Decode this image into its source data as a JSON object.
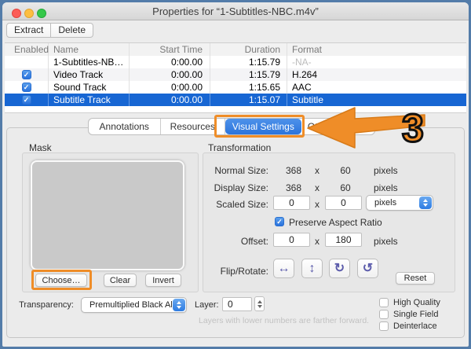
{
  "colors": {
    "accent_orange": "#ef8d28",
    "selection_blue": "#1766d3",
    "tab_blue": "#2f7de2"
  },
  "window": {
    "title": "Properties for “1-Subtitles-NBC.m4v”"
  },
  "toolbar": {
    "extract_label": "Extract",
    "delete_label": "Delete"
  },
  "track_table": {
    "columns": [
      "Enabled",
      "Name",
      "Start Time",
      "Duration",
      "Format"
    ],
    "rows": [
      {
        "enabled": false,
        "selected": false,
        "name": "1-Subtitles-NB…",
        "start_time": "0:00.00",
        "duration": "1:15.79",
        "format": "-NA-"
      },
      {
        "enabled": true,
        "selected": false,
        "name": "Video Track",
        "start_time": "0:00.00",
        "duration": "1:15.79",
        "format": "H.264"
      },
      {
        "enabled": true,
        "selected": false,
        "name": "Sound Track",
        "start_time": "0:00.00",
        "duration": "1:15.65",
        "format": "AAC"
      },
      {
        "enabled": true,
        "selected": true,
        "name": "Subtitle Track",
        "start_time": "0:00.00",
        "duration": "1:15.07",
        "format": "Subtitle"
      }
    ]
  },
  "tabs": [
    {
      "label": "Annotations",
      "selected": false
    },
    {
      "label": "Resources",
      "selected": false
    },
    {
      "label": "Visual Settings",
      "selected": true
    },
    {
      "label": "Other Settings",
      "selected": false
    }
  ],
  "annotation": {
    "step_number": "3"
  },
  "mask": {
    "title": "Mask",
    "choose_label": "Choose…",
    "clear_label": "Clear",
    "invert_label": "Invert"
  },
  "transformation": {
    "title": "Transformation",
    "normal_size_label": "Normal Size:",
    "normal_size_w": "368",
    "normal_size_h": "60",
    "display_size_label": "Display Size:",
    "display_size_w": "368",
    "display_size_h": "60",
    "scaled_size_label": "Scaled Size:",
    "scaled_size_w": "0",
    "scaled_size_h": "0",
    "times": "x",
    "unit": "pixels",
    "unit_dropdown_value": "pixels",
    "preserve_aspect_label": "Preserve Aspect Ratio",
    "preserve_aspect_checked": true,
    "offset_label": "Offset:",
    "offset_x": "0",
    "offset_y": "180",
    "flip_rotate_label": "Flip/Rotate:",
    "reset_label": "Reset"
  },
  "icons": {
    "check": "✓",
    "flip_horizontal": "↔",
    "flip_vertical": "↕",
    "rotate_cw": "↻",
    "rotate_ccw": "↺"
  },
  "footer": {
    "transparency_label": "Transparency:",
    "transparency_value": "Premultiplied Black Alpha",
    "layer_label": "Layer:",
    "layer_value": "0",
    "layer_hint": "Layers with lower numbers are farther forward.",
    "checkboxes": [
      {
        "label": "High Quality",
        "checked": false
      },
      {
        "label": "Single Field",
        "checked": false
      },
      {
        "label": "Deinterlace",
        "checked": false
      }
    ]
  }
}
